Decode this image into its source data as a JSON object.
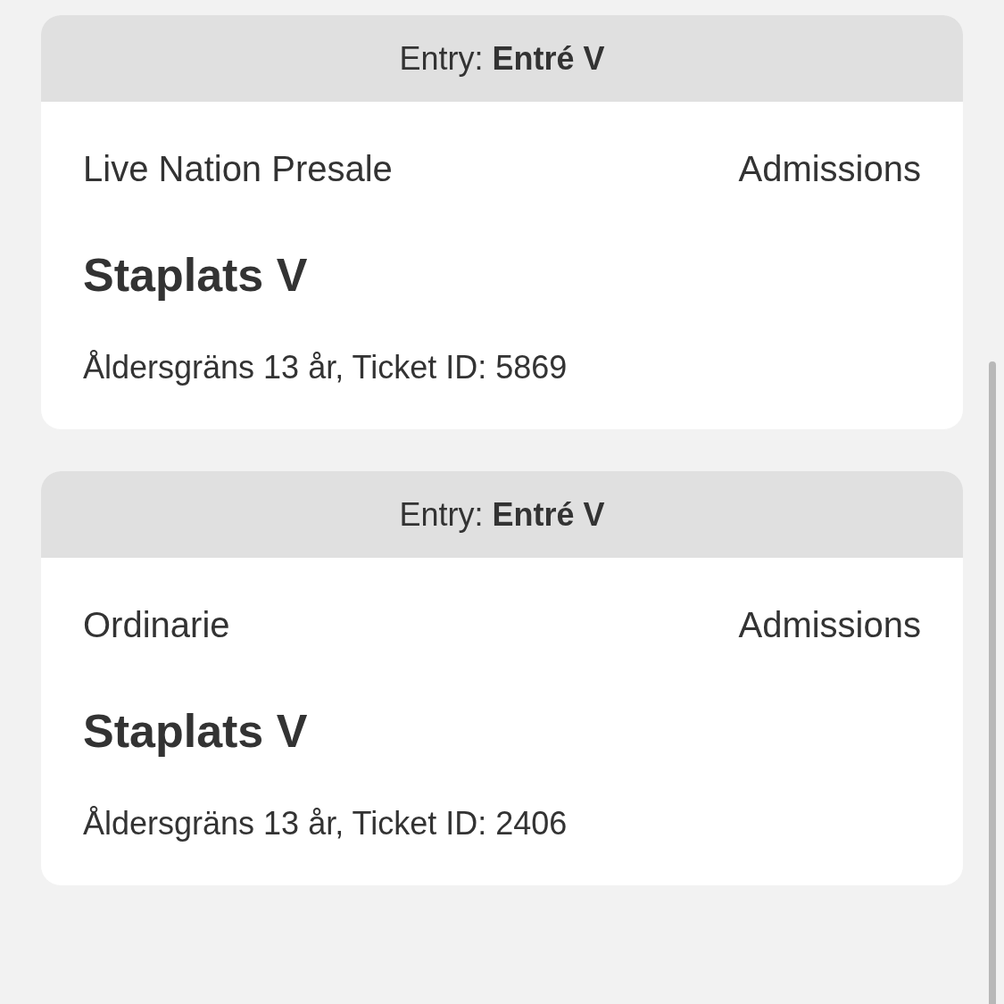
{
  "tickets": [
    {
      "header": "Entry: **Entré V**",
      "category": "Live Nation Presale",
      "type": "Admissions",
      "title": "Staplats V",
      "details": "Åldersgräns 13 år, Ticket ID: 5869"
    },
    {
      "header": "Entry: **Entré V**",
      "category": "Ordinarie",
      "type": "Admissions",
      "title": "Staplats V",
      "details": "Åldersgräns 13 år, Ticket ID: 2406"
    }
  ]
}
